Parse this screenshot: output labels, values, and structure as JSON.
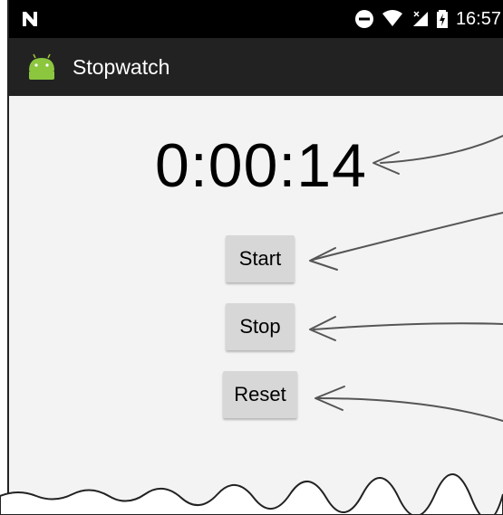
{
  "status_bar": {
    "time": "16:57",
    "icons": [
      "notification-n-icon",
      "do-not-disturb-icon",
      "wifi-icon",
      "cell-signal-icon",
      "battery-charging-icon"
    ]
  },
  "app_bar": {
    "title": "Stopwatch",
    "icon": "android-icon",
    "background": "#222222"
  },
  "stopwatch": {
    "time_display": "0:00:14"
  },
  "buttons": {
    "start_label": "Start",
    "stop_label": "Stop",
    "reset_label": "Reset"
  }
}
